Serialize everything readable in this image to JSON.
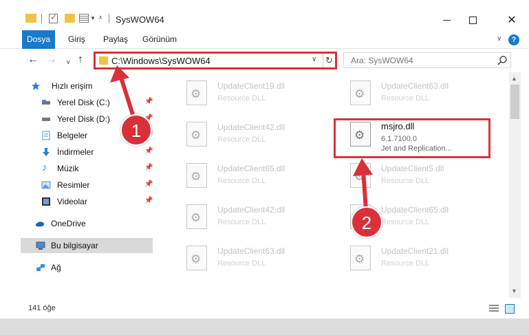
{
  "window": {
    "title": "SysWOW64"
  },
  "ribbon": {
    "tabs": [
      {
        "label": "Dosya"
      },
      {
        "label": "Giriş"
      },
      {
        "label": "Paylaş"
      },
      {
        "label": "Görünüm"
      }
    ],
    "help_label": "?"
  },
  "address": {
    "path": "C:\\Windows\\SysWOW64"
  },
  "search": {
    "placeholder": "Ara: SysWOW64"
  },
  "sidebar": {
    "items": [
      {
        "label": "Hızlı erişim",
        "icon": "star-icon"
      },
      {
        "label": "Yerel Disk (C:)",
        "icon": "drive-icon",
        "pinned": true
      },
      {
        "label": "Yerel Disk (D:)",
        "icon": "drive-icon",
        "pinned": true
      },
      {
        "label": "Belgeler",
        "icon": "documents-icon",
        "pinned": true
      },
      {
        "label": "İndirmeler",
        "icon": "download-icon",
        "pinned": true
      },
      {
        "label": "Müzik",
        "icon": "music-icon",
        "pinned": true
      },
      {
        "label": "Resimler",
        "icon": "pictures-icon",
        "pinned": true
      },
      {
        "label": "Videolar",
        "icon": "videos-icon",
        "pinned": true
      },
      {
        "label": "OneDrive",
        "icon": "cloud-icon"
      },
      {
        "label": "Bu bilgisayar",
        "icon": "computer-icon",
        "selected": true
      },
      {
        "label": "Ağ",
        "icon": "network-icon"
      }
    ]
  },
  "files": [
    {
      "name": "UpdateClient19.dll",
      "desc": "Resource DLL"
    },
    {
      "name": "UpdateClient63.dll",
      "desc": "Resource DLL"
    },
    {
      "name": "UpdateClient42.dll",
      "desc": "Resource DLL"
    },
    {
      "name": "msjro.dll",
      "version": "6.1.7100.0",
      "desc": "Jet and Replication...",
      "highlighted": true
    },
    {
      "name": "UpdateClient65.dll",
      "desc": "Resource DLL"
    },
    {
      "name": "UpdateClient5.dll",
      "desc": "Resource DLL"
    },
    {
      "name": "UpdateClient42.dll",
      "desc": "Resource DLL"
    },
    {
      "name": "UpdateClient65.dll",
      "desc": "Resource DLL"
    },
    {
      "name": "UpdateClient63.dll",
      "desc": "Resource DLL"
    },
    {
      "name": "UpdateClient21.dll",
      "desc": "Resource DLL"
    }
  ],
  "status": {
    "item_count": "141 öğe"
  },
  "annotations": {
    "marker1": "1",
    "marker2": "2",
    "color": "#d9303a"
  },
  "colors": {
    "accent": "#1979ca",
    "highlight": "#d9303a",
    "folder": "#f0c24a"
  }
}
